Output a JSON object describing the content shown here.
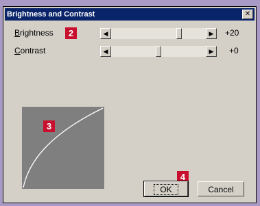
{
  "dialog": {
    "title": "Brightness and Contrast",
    "close_symbol": "✕"
  },
  "controls": {
    "brightness": {
      "label_accel": "B",
      "label_rest": "rightness",
      "value": "+20",
      "level_percent": 62
    },
    "contrast": {
      "label_accel": "C",
      "label_rest": "ontrast",
      "value": "+0",
      "level_percent": 50
    }
  },
  "scroll": {
    "left_arrow": "◀",
    "right_arrow": "▶"
  },
  "callouts": {
    "b2": "2",
    "b3": "3",
    "b4": "4"
  },
  "buttons": {
    "ok": "OK",
    "cancel": "Cancel"
  },
  "icons": [
    "close-icon",
    "scroll-left-icon",
    "scroll-right-icon"
  ]
}
